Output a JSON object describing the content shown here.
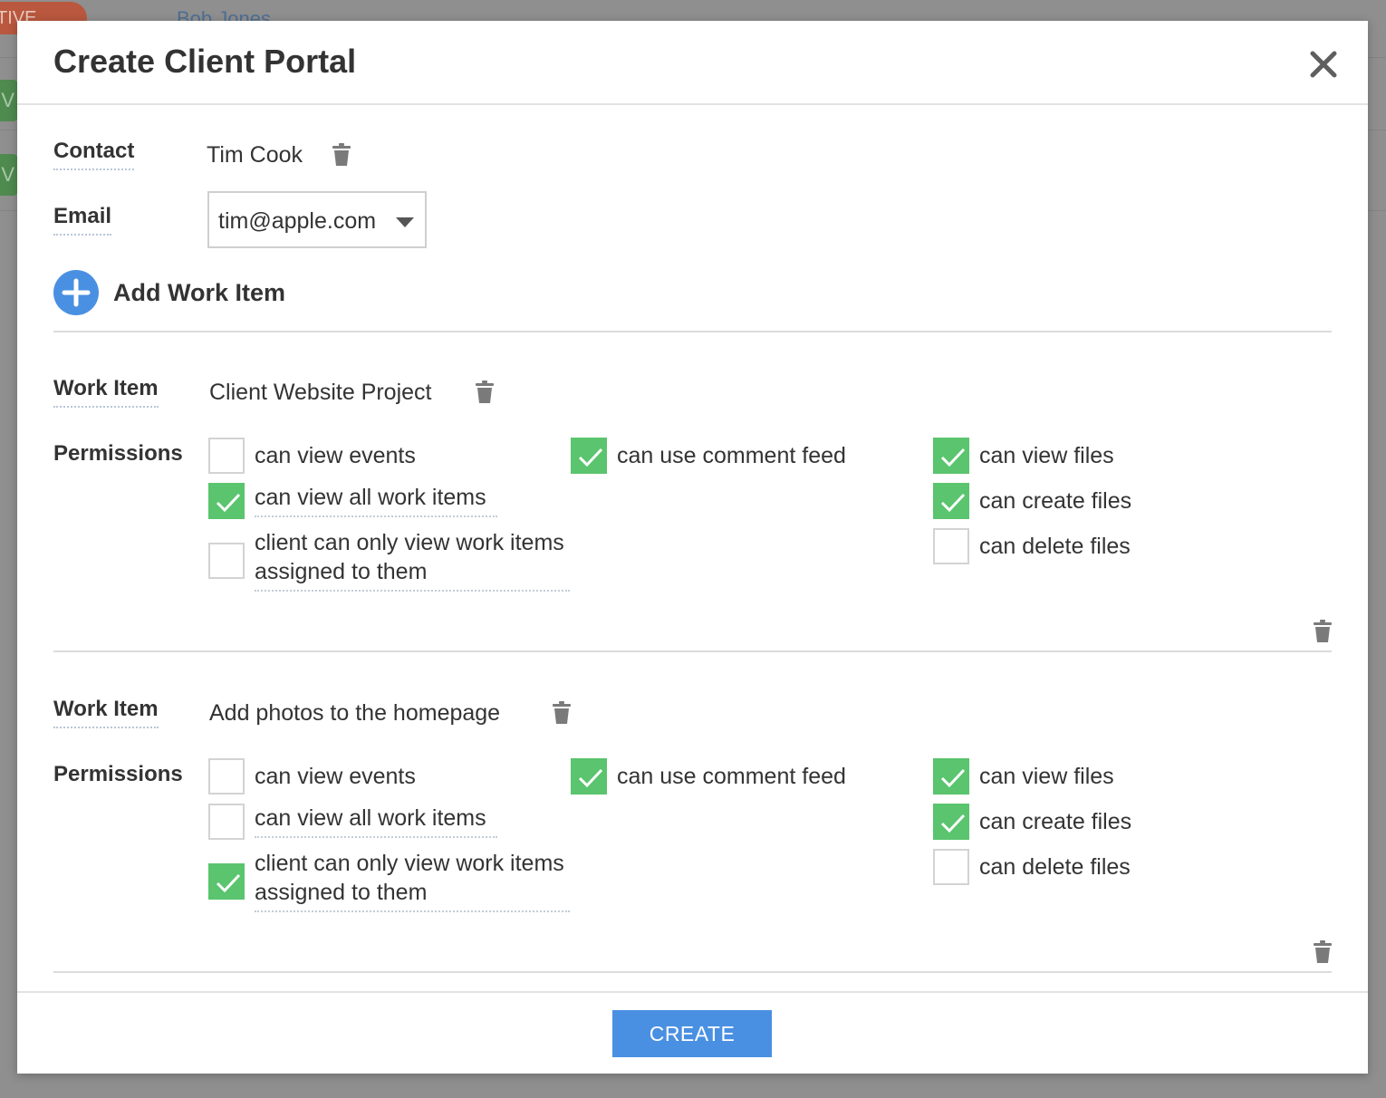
{
  "background": {
    "badge_text": "TIVE",
    "link_text": "Bob Jones",
    "badge2_text": "V",
    "badge3_text": "V"
  },
  "modal": {
    "title": "Create Client Portal",
    "close_glyph": "✕"
  },
  "contact": {
    "label": "Contact",
    "value": "Tim Cook"
  },
  "email": {
    "label": "Email",
    "value": "tim@apple.com"
  },
  "add_work_item": {
    "label": "Add Work Item"
  },
  "work_items": [
    {
      "label": "Work Item",
      "name": "Client Website Project",
      "permissions_label": "Permissions",
      "permissions": {
        "view_events": {
          "label": "can view events",
          "checked": false
        },
        "view_all_work_items": {
          "label": "can view all work items",
          "checked": true
        },
        "only_assigned": {
          "label": "client can only view work items assigned to them",
          "checked": false
        },
        "comment_feed": {
          "label": "can use comment feed",
          "checked": true
        },
        "view_files": {
          "label": "can view files",
          "checked": true
        },
        "create_files": {
          "label": "can create files",
          "checked": true
        },
        "delete_files": {
          "label": "can delete files",
          "checked": false
        }
      }
    },
    {
      "label": "Work Item",
      "name": "Add photos to the homepage",
      "permissions_label": "Permissions",
      "permissions": {
        "view_events": {
          "label": "can view events",
          "checked": false
        },
        "view_all_work_items": {
          "label": "can view all work items",
          "checked": false
        },
        "only_assigned": {
          "label": "client can only view work items assigned to them",
          "checked": true
        },
        "comment_feed": {
          "label": "can use comment feed",
          "checked": true
        },
        "view_files": {
          "label": "can view files",
          "checked": true
        },
        "create_files": {
          "label": "can create files",
          "checked": true
        },
        "delete_files": {
          "label": "can delete files",
          "checked": false
        }
      }
    }
  ],
  "footer": {
    "create_label": "CREATE"
  },
  "colors": {
    "accent": "#4a90e2",
    "checked": "#5ac46e",
    "overlay": "#8c8c8c"
  },
  "icons": [
    "close-icon",
    "trash-icon",
    "chevron-down-icon",
    "plus-icon",
    "checkmark-icon"
  ]
}
